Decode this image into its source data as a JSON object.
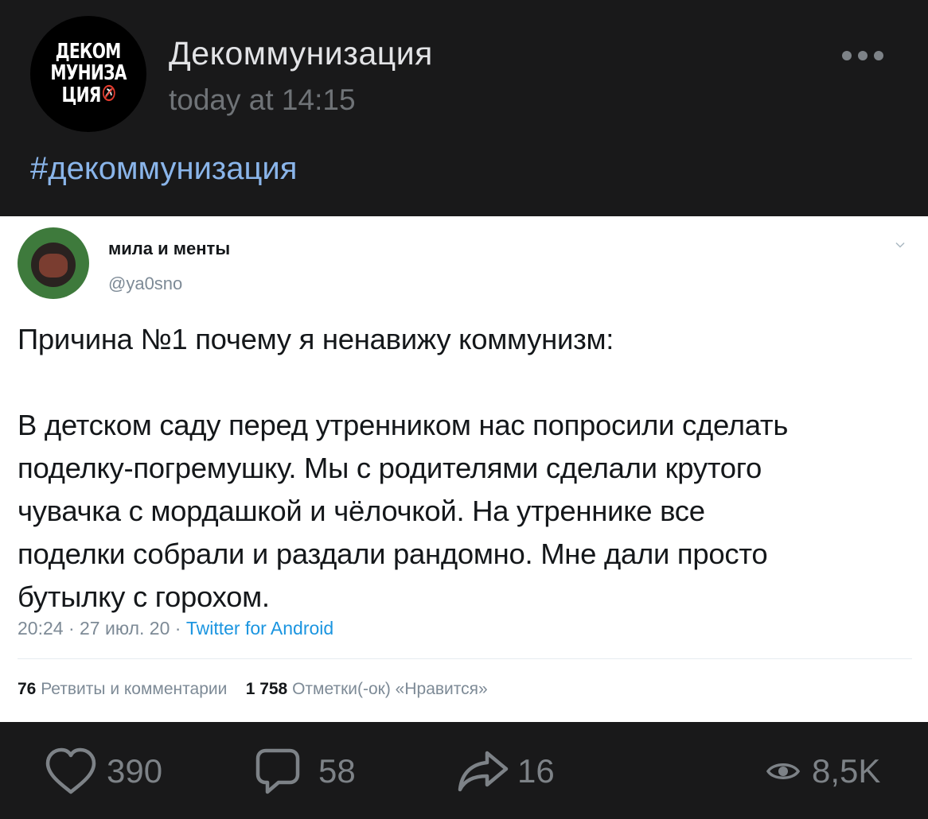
{
  "post": {
    "avatar_text": [
      "ДЕКОМ",
      "МУНИЗА",
      "ЦИЯ"
    ],
    "group_name": "Декоммунизация",
    "timestamp": "today at 14:15",
    "hashtag": "#декоммунизация"
  },
  "tweet": {
    "author_name": "мила и менты",
    "handle": "@ya0sno",
    "text_lines": [
      "Причина №1 почему я ненавижу коммунизм:",
      "",
      "В детском саду перед утренником нас попросили сделать",
      "поделку-погремушку. Мы с родителями сделали крутого",
      "чувачка с мордашкой и чёлочкой. На утреннике все",
      "поделки собрали и раздали рандомно. Мне дали просто",
      "бутылку с горохом."
    ],
    "time": "20:24",
    "date": "27 июл. 20",
    "source": "Twitter for Android",
    "retweets_count": "76",
    "retweets_label": "Ретвиты и комментарии",
    "likes_count": "1 758",
    "likes_label": "Отметки(-ок) «Нравится»"
  },
  "footer": {
    "likes": "390",
    "comments": "58",
    "shares": "16",
    "views": "8,5K"
  },
  "colors": {
    "background": "#19191a",
    "link": "#8ab5ea",
    "muted": "#7d8287",
    "twitter_link": "#1b95e0"
  }
}
